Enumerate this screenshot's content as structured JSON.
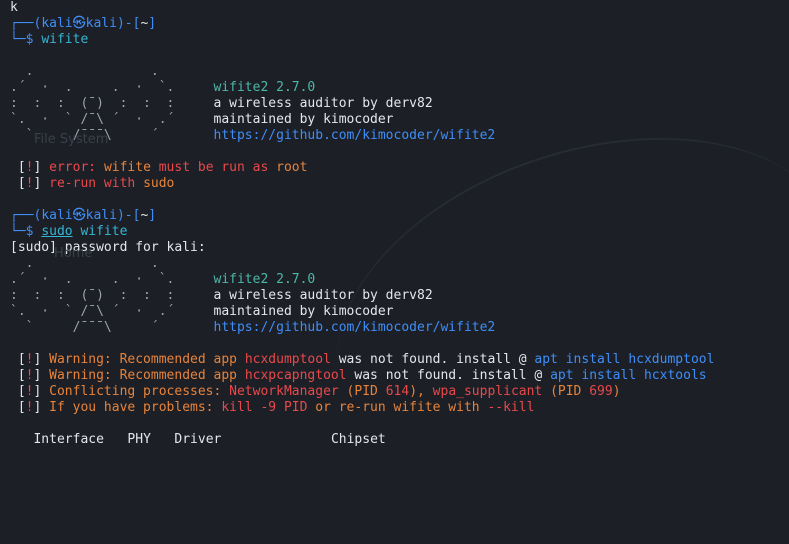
{
  "top_char": "k",
  "prompt1": {
    "user": "kali",
    "at": "㉿",
    "host": "kali",
    "dir": "~",
    "command": "wifite"
  },
  "banner": {
    "art": [
      "  .               .    ",
      ".´  ·  .     .  ·  `.  ",
      ":  :  :  (¯)  :  :  :  ",
      "`.  ·  ` /¯\\ ´  ·  .´  ",
      "  `     /¯¯¯\\     ´    "
    ],
    "version": "wifite2 2.7.0",
    "desc": "a wireless auditor by derv82",
    "maint": "maintained by kimocoder",
    "url": "https://github.com/kimocoder/wifite2"
  },
  "error1": {
    "bang": "!",
    "a": "error: ",
    "b": "wifite",
    "c": " must be run as ",
    "d": "root"
  },
  "error2": {
    "bang": "!",
    "a": "re-run with ",
    "b": "sudo"
  },
  "prompt2": {
    "user": "kali",
    "at": "㉿",
    "host": "kali",
    "dir": "~",
    "sudo": "sudo",
    "command": "wifite"
  },
  "sudo_prompt": "[sudo] password for kali:",
  "warn1": {
    "bang": "!",
    "a": "Warning: Recommended app ",
    "app": "hcxdumptool",
    "b": " was not found. install @ ",
    "c": "apt install hcxdumptool"
  },
  "warn2": {
    "bang": "!",
    "a": "Warning: Recommended app ",
    "app": "hcxpcapngtool",
    "b": " was not found. install @ ",
    "c": "apt install hcxtools"
  },
  "conflict": {
    "bang": "!",
    "a": "Conflicting processes: ",
    "p1": "NetworkManager",
    "p1b": " (PID ",
    "pid1": "614",
    "p1c": "), ",
    "p2": "wpa_supplicant",
    "p2b": " (PID ",
    "pid2": "699",
    "p2c": ")"
  },
  "problems": {
    "bang": "!",
    "a": "If you have problems: ",
    "b": "kill -9 PID",
    "c": " or re-run wifite with ",
    "d": "--kill"
  },
  "table_header": {
    "iface": "Interface",
    "phy": "PHY",
    "driver": "Driver",
    "chipset": "Chipset"
  },
  "ghosts": {
    "fs": "File System",
    "home": "Home"
  }
}
